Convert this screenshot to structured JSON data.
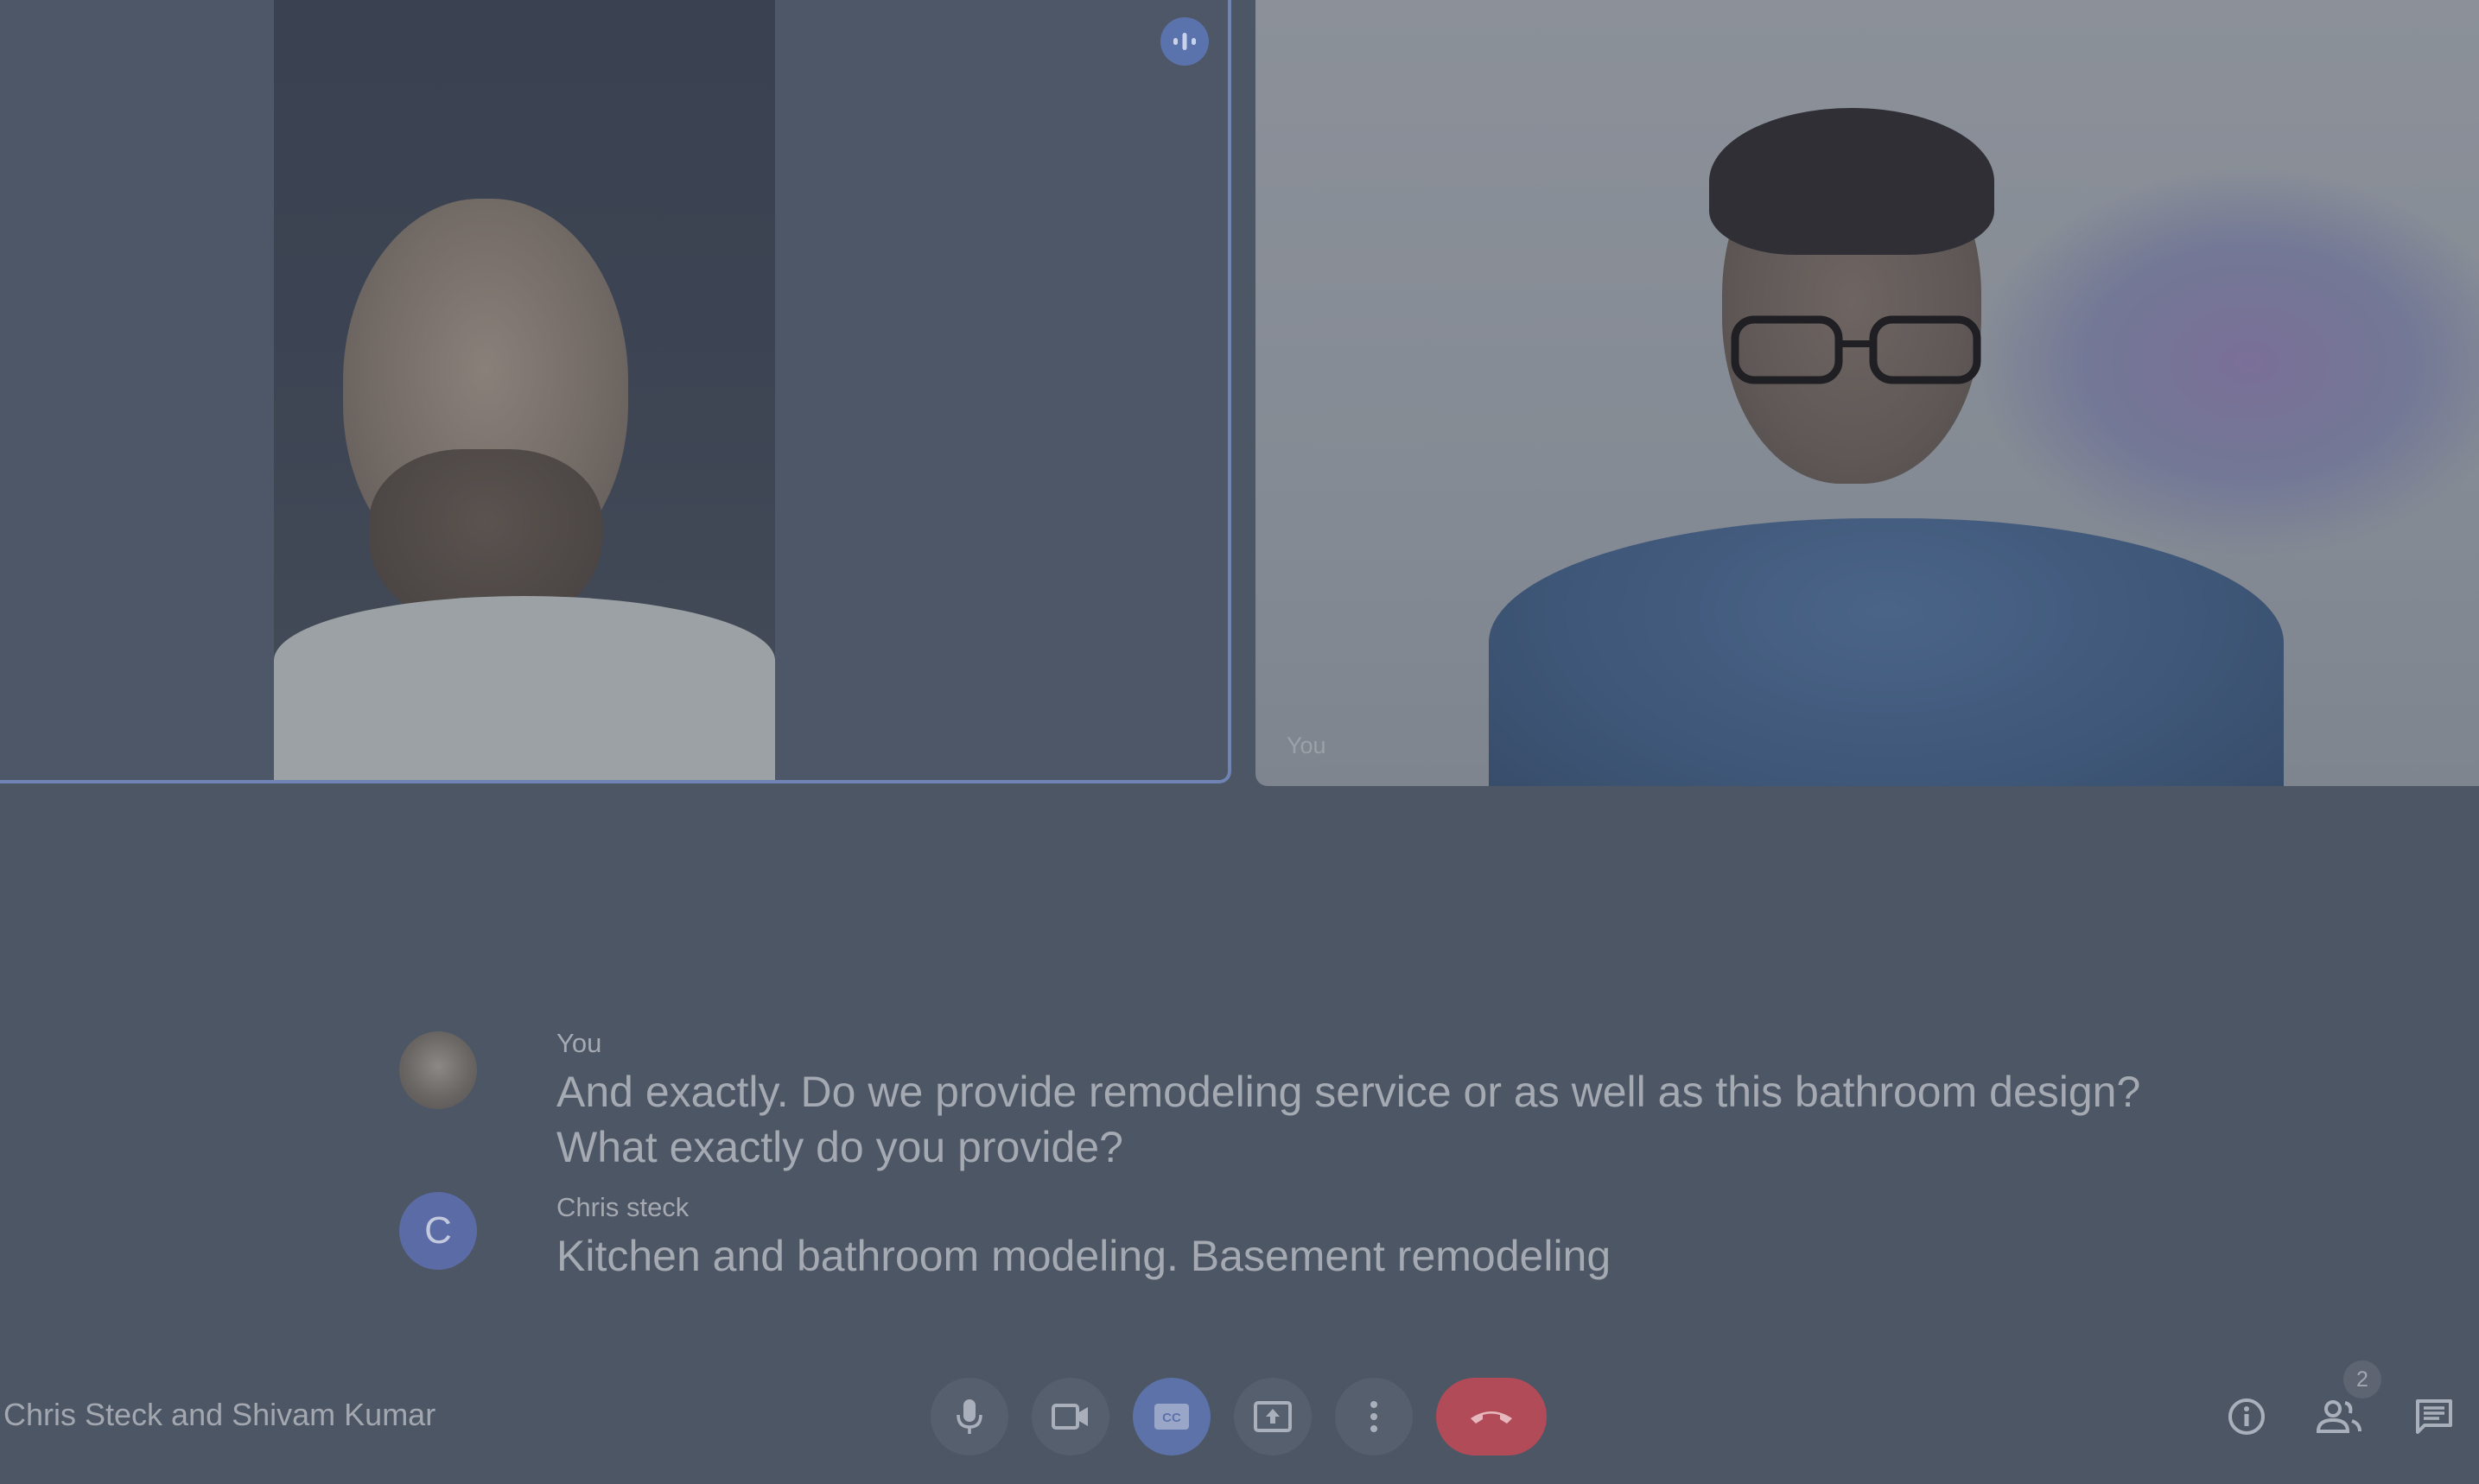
{
  "remote_participant": {
    "name": "Chris Steck",
    "speaking": true
  },
  "self_tile": {
    "label": "You"
  },
  "captions": [
    {
      "speaker": "You",
      "avatar": "photo",
      "text": "And exactly. Do we provide remodeling service or as well as this bathroom design? What exactly do you provide?"
    },
    {
      "speaker": "Chris steck",
      "avatar_letter": "C",
      "text": "Kitchen and bathroom modeling. Basement remodeling"
    }
  ],
  "meeting": {
    "title": "Chris Steck and Shivam Kumar"
  },
  "controls": {
    "mic": "microphone-icon",
    "camera": "camera-icon",
    "captions": "closed-captions-icon",
    "present": "present-screen-icon",
    "more": "more-options-icon",
    "end_call": "end-call-icon"
  },
  "side_panel": {
    "info": "info-icon",
    "people": "people-icon",
    "people_count": "2",
    "chat": "chat-icon"
  },
  "colors": {
    "background": "#4d5665",
    "active_speaker_border": "#6f84b5",
    "captions_active": "#5c72a8",
    "end_call": "#b24b58",
    "avatar_c": "#5b6ba6"
  }
}
